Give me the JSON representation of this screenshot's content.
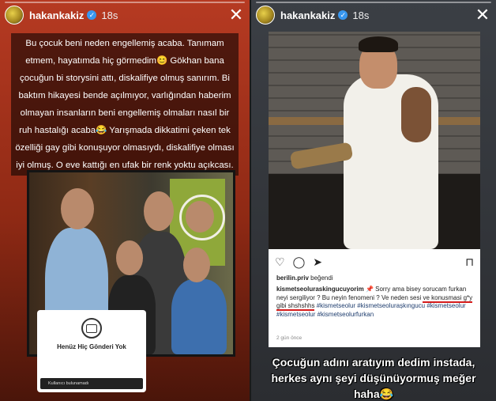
{
  "left_story": {
    "username": "hakankakiz",
    "verified": "✓",
    "time": "18s",
    "close": "✕",
    "text": "Bu çocuk beni neden engellemiş acaba. Tanımam etmem, hayatımda hiç görmedim😊 Gökhan bana çocuğun bi storysini attı, diskalifiye olmuş sanırım. Bi baktım hikayesi bende açılmıyor, varlığından haberim olmayan insanların beni engellemiş olmaları nasıl bir ruh hastalığı acaba😂 Yarışmada dikkatimi çeken tek özelliği gay gibi konuşuyor olmasıydı, diskalifiye olması iyi olmuş. O eve kattığı en ufak bir renk yoktu açıkcası.",
    "no_post_title": "Henüz Hiç Gönderi Yok",
    "no_post_status": "Kullanıcı bulunamadı"
  },
  "right_story": {
    "username": "hakankakiz",
    "verified": "✓",
    "time": "18s",
    "close": "✕",
    "post": {
      "liked_by_user": "berilin.priv",
      "liked_suffix": " beğendi",
      "caption_user": "kismetseoluraskingucuyorim",
      "caption_1": " 📌 Sorry ama bisey sorucam furkan neyi sergiliyor ? Bu neyin fenomeni ? Ve neden sesi ",
      "caption_underlined": "ve konusmasi g*y gibi shshshhs",
      "caption_tags": " #kismetseolur #kismetseolurașkıngucu #kismetseolur #kismetseolur #kismetseolurfurkan",
      "ago": "2 gün önce"
    },
    "bottom_text": "Çocuğun adını aratıyım dedim instada, herkes aynı şeyi düşünüyormuş meğer haha😂"
  },
  "icons": {
    "heart": "♡",
    "comment": "◯",
    "share": "➤",
    "bookmark": "⊓"
  }
}
